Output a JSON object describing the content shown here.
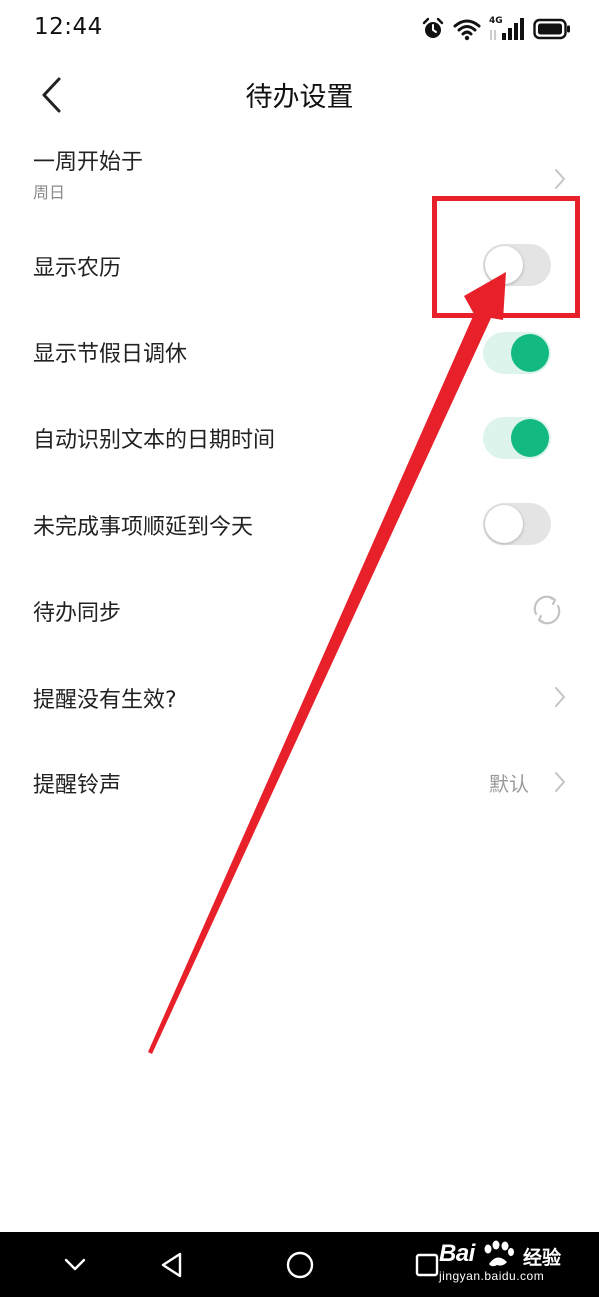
{
  "status_bar": {
    "time": "12:44",
    "icons": [
      "alarm-icon",
      "wifi-icon",
      "cellular-4g-icon",
      "battery-icon"
    ],
    "network_label": "4G"
  },
  "header": {
    "title": "待办设置",
    "back_icon": "chevron-left-icon"
  },
  "settings": {
    "week_start": {
      "label": "一周开始于",
      "value": "周日"
    },
    "show_lunar": {
      "label": "显示农历",
      "enabled": false
    },
    "show_holidays": {
      "label": "显示节假日调休",
      "enabled": true
    },
    "auto_detect_date": {
      "label": "自动识别文本的日期时间",
      "enabled": true
    },
    "postpone_unfinished": {
      "label": "未完成事项顺延到今天",
      "enabled": false
    },
    "todo_sync": {
      "label": "待办同步",
      "icon": "sync-icon"
    },
    "reminder_not_working": {
      "label": "提醒没有生效?"
    },
    "reminder_ringtone": {
      "label": "提醒铃声",
      "value": "默认"
    }
  },
  "annotation": {
    "color": "#e8202a",
    "target": "show_lunar toggle"
  },
  "nav_bar": {
    "buttons": [
      "nav-down-icon",
      "back-triangle-icon",
      "home-circle-icon",
      "recents-square-icon"
    ]
  },
  "watermark": {
    "brand": "Bai",
    "suffix": "经验",
    "url": "jingyan.baidu.com"
  },
  "colors": {
    "accent_green": "#12b981",
    "toggle_on_track": "#ddf4ec",
    "toggle_off_track": "#e4e4e4",
    "annotation_red": "#e8202a"
  }
}
